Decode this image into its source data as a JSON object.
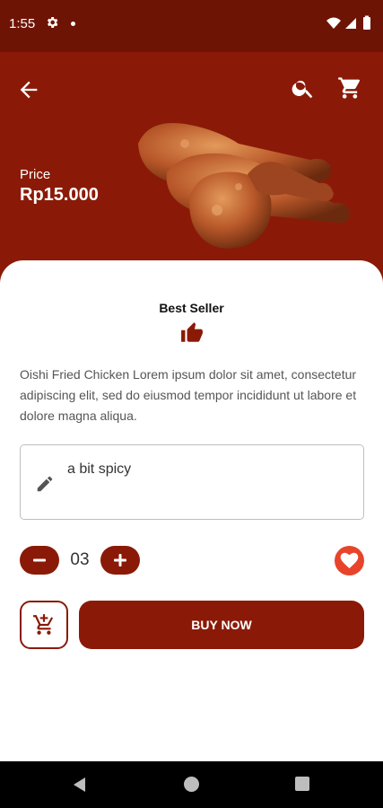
{
  "status_bar": {
    "time": "1:55",
    "icons": [
      "gear-icon",
      "notification-dot-icon",
      "wifi-icon",
      "cellular-icon",
      "battery-icon"
    ]
  },
  "header": {
    "back_icon": "arrow-left-icon",
    "search_icon": "search-icon",
    "cart_icon": "cart-icon"
  },
  "product": {
    "price_label": "Price",
    "price_value": "Rp15.000",
    "badge": "Best Seller",
    "badge_icon": "thumbs-up-icon",
    "description": "Oishi Fried Chicken Lorem ipsum dolor sit amet, consectetur adipiscing elit, sed do eiusmod tempor incididunt ut labore et dolore magna aliqua."
  },
  "note": {
    "icon": "pencil-icon",
    "value": "a bit spicy"
  },
  "quantity": {
    "value": "03"
  },
  "actions": {
    "buy_label": "BUY NOW",
    "add_to_cart_icon": "cart-plus-icon",
    "favorite_icon": "heart-icon"
  },
  "colors": {
    "primary": "#8a1a07",
    "status_bar": "#6e1405",
    "favorite": "#e8442b"
  }
}
